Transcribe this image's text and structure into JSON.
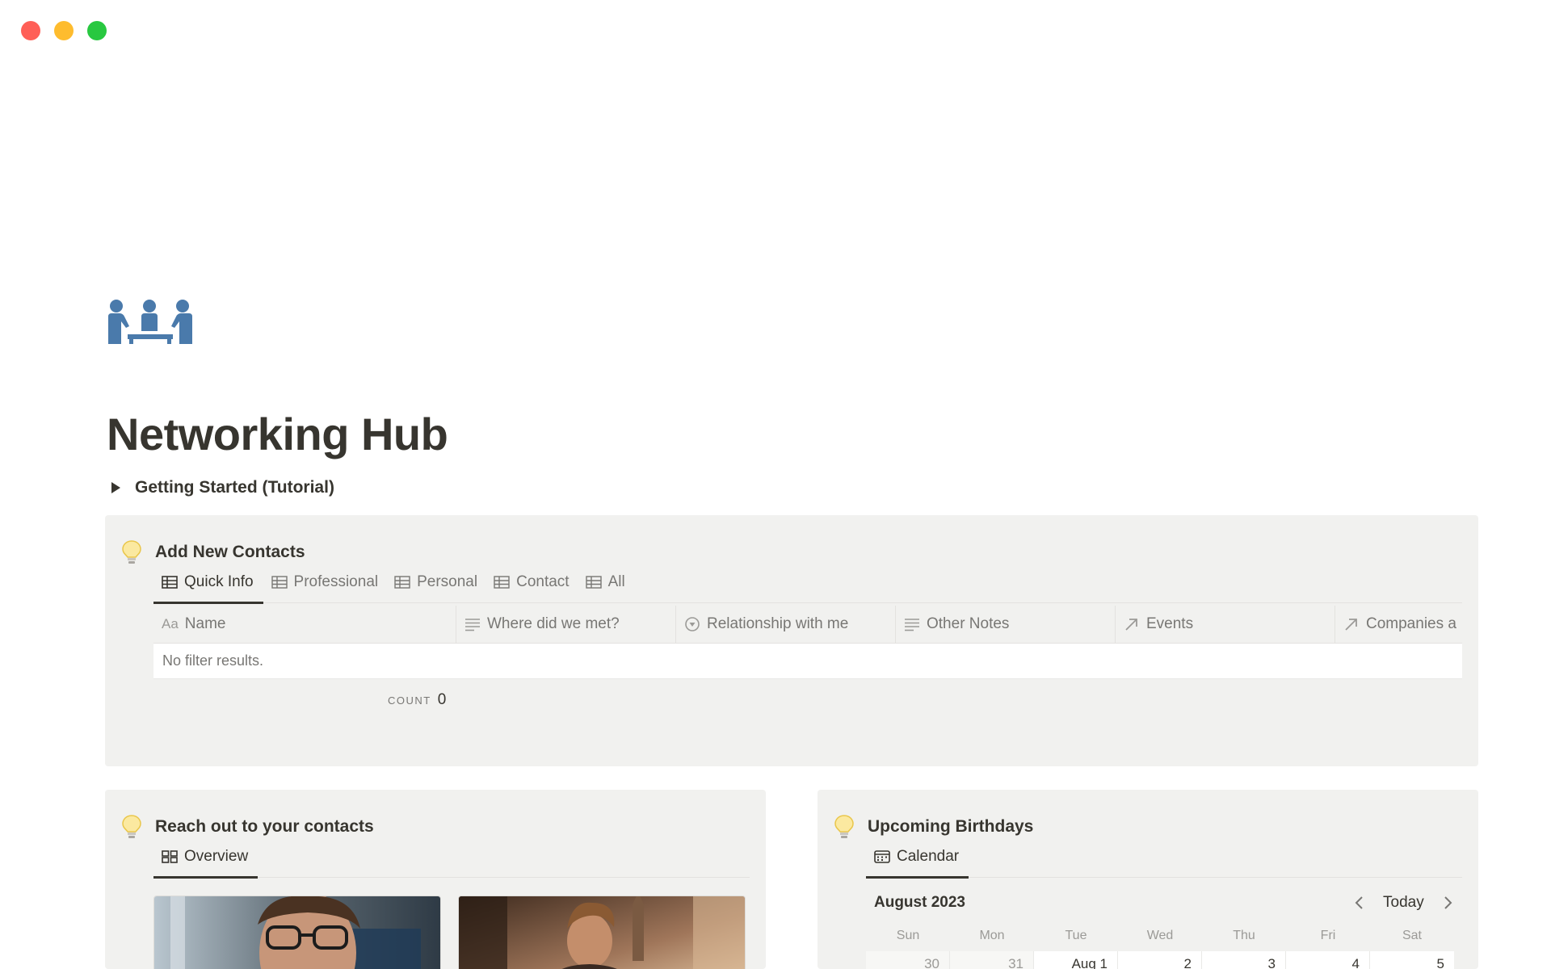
{
  "window": {
    "buttons": [
      "close",
      "minimize",
      "zoom"
    ]
  },
  "page": {
    "icon": "people-meeting-icon",
    "title": "Networking Hub"
  },
  "toggle": {
    "label": "Getting Started (Tutorial)"
  },
  "add_contacts": {
    "title": "Add New Contacts",
    "icon": "lightbulb-icon",
    "tabs": [
      {
        "label": "Quick Info",
        "icon": "table-icon",
        "active": true
      },
      {
        "label": "Professional",
        "icon": "table-icon",
        "active": false
      },
      {
        "label": "Personal",
        "icon": "table-icon",
        "active": false
      },
      {
        "label": "Contact",
        "icon": "table-icon",
        "active": false
      },
      {
        "label": "All",
        "icon": "table-icon",
        "active": false
      }
    ],
    "columns": [
      {
        "label": "Name",
        "prefix": "Aa",
        "icon": "title-icon"
      },
      {
        "label": "Where did we met?",
        "icon": "text-lines-icon"
      },
      {
        "label": "Relationship with me",
        "icon": "status-circle-icon"
      },
      {
        "label": "Other Notes",
        "icon": "text-lines-icon"
      },
      {
        "label": "Events",
        "icon": "relation-arrow-icon"
      },
      {
        "label": "Companies a",
        "icon": "relation-arrow-icon"
      }
    ],
    "empty_text": "No filter results.",
    "count_label": "COUNT",
    "count_value": "0"
  },
  "reach_out": {
    "title": "Reach out to your contacts",
    "icon": "lightbulb-icon",
    "tabs": [
      {
        "label": "Overview",
        "icon": "gallery-icon",
        "active": true
      }
    ],
    "cards": [
      {
        "image": "man-with-glasses-photo"
      },
      {
        "image": "man-in-city-street-photo"
      }
    ]
  },
  "birthdays": {
    "title": "Upcoming Birthdays",
    "icon": "lightbulb-icon",
    "tabs": [
      {
        "label": "Calendar",
        "icon": "calendar-icon",
        "active": true
      }
    ],
    "month": "August 2023",
    "today_label": "Today",
    "weekdays": [
      "Sun",
      "Mon",
      "Tue",
      "Wed",
      "Thu",
      "Fri",
      "Sat"
    ],
    "first_week": [
      "30",
      "31",
      "Aug 1",
      "2",
      "3",
      "4",
      "5"
    ]
  },
  "colors": {
    "text": "#37352f",
    "muted": "#787774",
    "callout_bg": "#f1f1ef",
    "icon_blue": "#4a7aab"
  }
}
